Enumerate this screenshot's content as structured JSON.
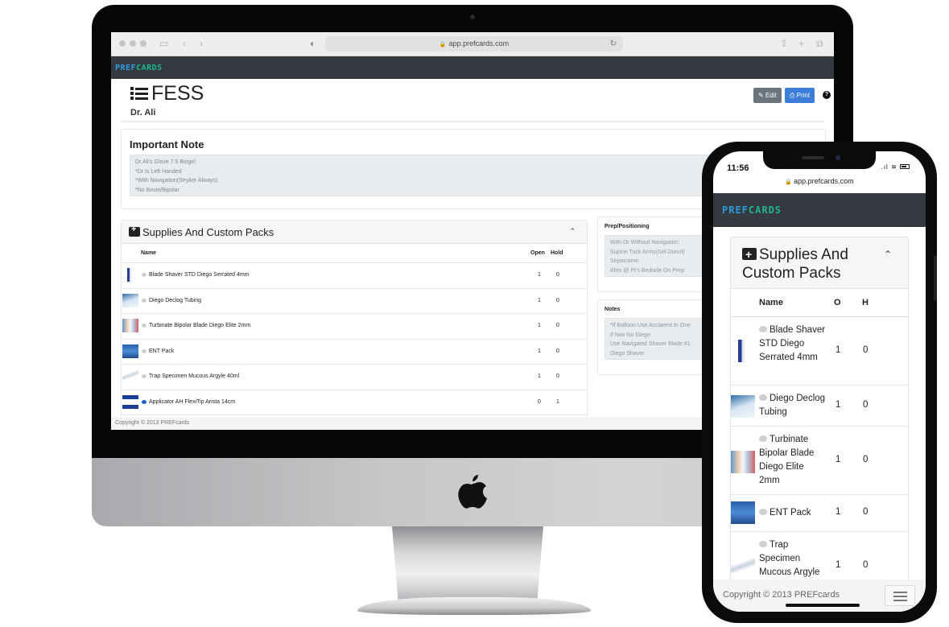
{
  "desktop": {
    "browser": {
      "url": "app.prefcards.com",
      "toolbar_icons": [
        "sidebar-icon",
        "back-icon",
        "forward-icon",
        "shield-icon",
        "reload-icon",
        "share-icon",
        "new-tab-icon",
        "tabs-icon"
      ]
    },
    "brand": {
      "part1": "PREF",
      "part2": "CARDS",
      "color1": "#2f9bd8",
      "color2": "#21b58c"
    },
    "header": {
      "title": "FESS",
      "doctor": "Dr. Ali",
      "edit_label": "Edit",
      "print_label": "Print",
      "help_label": "?"
    },
    "important_note": {
      "title": "Important Note",
      "lines": [
        "Dr.Ali's Glove  7.5 Biogel",
        "*Dr Is Left Handed",
        "*With Navigation(Stryker Always)",
        "*No Bovie/Bipolar"
      ]
    },
    "supplies": {
      "title": "Supplies And Custom Packs",
      "columns": {
        "name": "Name",
        "open": "Open",
        "hold": "Hold"
      },
      "rows": [
        {
          "name": "Blade Shaver STD Diego Serrated 4mm",
          "open": "1",
          "hold": "0",
          "comment": false
        },
        {
          "name": "Diego Declog Tubing",
          "open": "1",
          "hold": "0",
          "comment": false
        },
        {
          "name": "Turbinate Bipolar Blade Diego Elite 2mm",
          "open": "1",
          "hold": "0",
          "comment": false
        },
        {
          "name": "ENT Pack",
          "open": "1",
          "hold": "0",
          "comment": false
        },
        {
          "name": "Trap Specimen Mucous Argyle 40ml",
          "open": "1",
          "hold": "0",
          "comment": false
        },
        {
          "name": "Applicator AH FlexiTip Arista 14cm",
          "open": "0",
          "hold": "1",
          "comment": true
        }
      ]
    },
    "prep": {
      "title": "Prep/Positioning",
      "lines": [
        "With Or Without Navigation:",
        "Supine Tuck Arms(Gel Donut)",
        "Septocaine",
        "Afrin @ Pt's Bedside On Prep"
      ]
    },
    "notes": {
      "title": "Notes",
      "lines": [
        "*If Balloon Use Acclarent In One",
        "If Nav-No Diego",
        "Use Navigated Shaver Blade #1",
        "Diego Shaver"
      ]
    },
    "footer": "Copyright © 2013 PREFcards"
  },
  "mobile": {
    "status": {
      "time": "11:56"
    },
    "url": "app.prefcards.com",
    "brand": {
      "part1": "PREF",
      "part2": "CARDS"
    },
    "supplies": {
      "title": "Supplies And Custom Packs",
      "columns": {
        "name": "Name",
        "open": "O",
        "hold": "H"
      },
      "rows": [
        {
          "name": "Blade Shaver STD Diego Serrated 4mm",
          "open": "1",
          "hold": "0"
        },
        {
          "name": "Diego Declog Tubing",
          "open": "1",
          "hold": "0"
        },
        {
          "name": "Turbinate Bipolar Blade Diego Elite 2mm",
          "open": "1",
          "hold": "0"
        },
        {
          "name": "ENT Pack",
          "open": "1",
          "hold": "0"
        },
        {
          "name": "Trap Specimen Mucous Argyle",
          "open": "1",
          "hold": "0"
        }
      ]
    },
    "footer": "Copyright © 2013 PREFcards"
  }
}
